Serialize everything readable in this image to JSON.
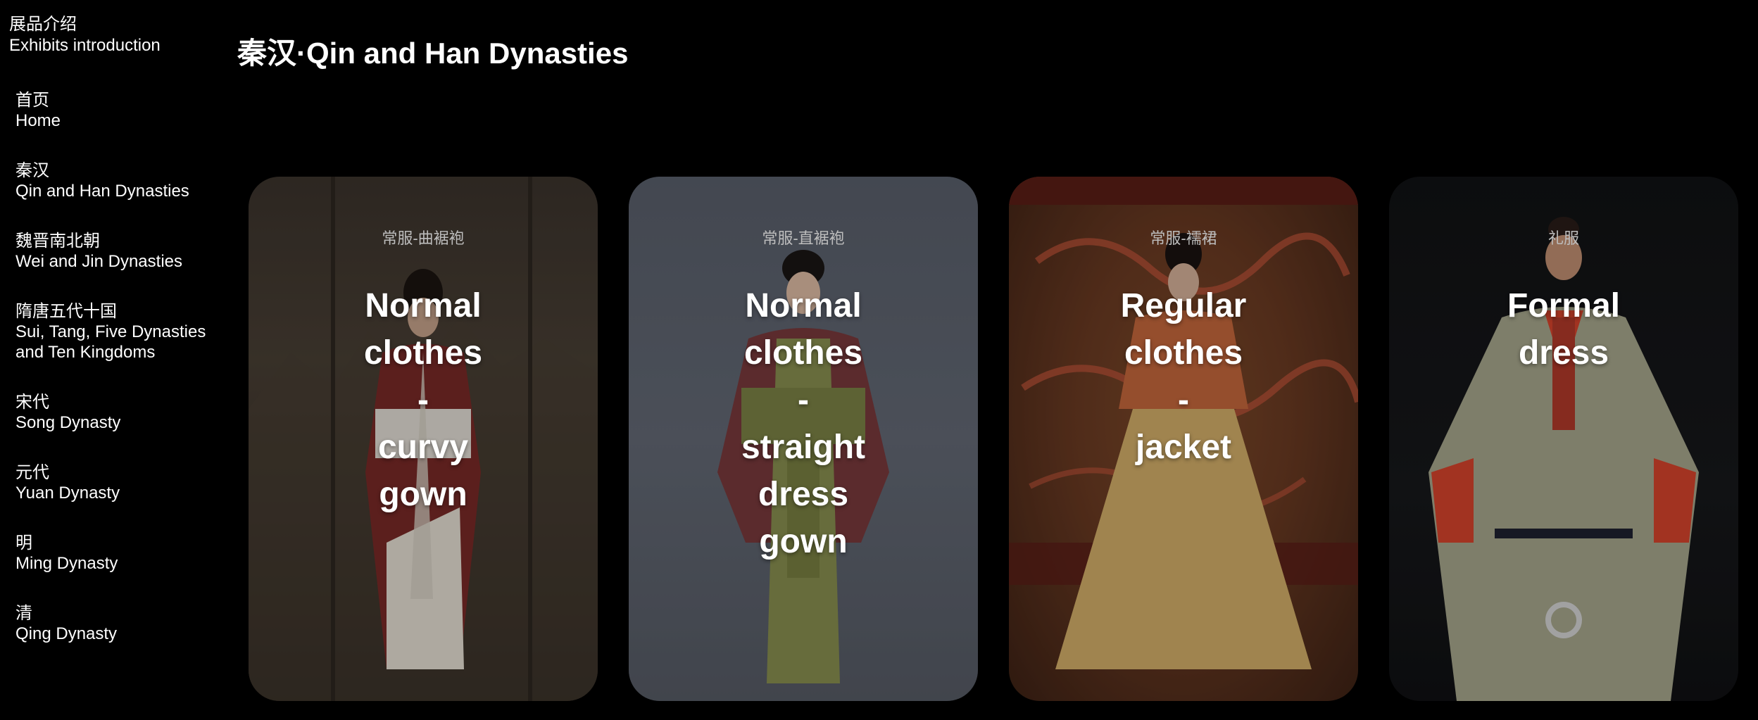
{
  "sidebar": {
    "header_zh": "展品介绍",
    "header_en": "Exhibits introduction",
    "items": [
      {
        "zh": "首页",
        "en": "Home"
      },
      {
        "zh": "秦汉",
        "en": "Qin and Han Dynasties"
      },
      {
        "zh": "魏晋南北朝",
        "en": "Wei and Jin Dynasties"
      },
      {
        "zh": "隋唐五代十国",
        "en": "Sui, Tang, Five Dynasties and Ten Kingdoms"
      },
      {
        "zh": "宋代",
        "en": "Song Dynasty"
      },
      {
        "zh": "元代",
        "en": "Yuan Dynasty"
      },
      {
        "zh": "明",
        "en": "Ming Dynasty"
      },
      {
        "zh": "清",
        "en": "Qing Dynasty"
      }
    ]
  },
  "main": {
    "title": "秦汉·Qin and Han Dynasties",
    "cards": [
      {
        "tag": "常服-曲裾袍",
        "label": "Normal\nclothes\n-\ncurvy\ngown"
      },
      {
        "tag": "常服-直裾袍",
        "label": "Normal\nclothes\n-\nstraight\ndress\ngown"
      },
      {
        "tag": "常服-襦裙",
        "label": "Regular\nclothes\n-\njacket"
      },
      {
        "tag": "礼服",
        "label": "Formal\ndress"
      }
    ]
  }
}
